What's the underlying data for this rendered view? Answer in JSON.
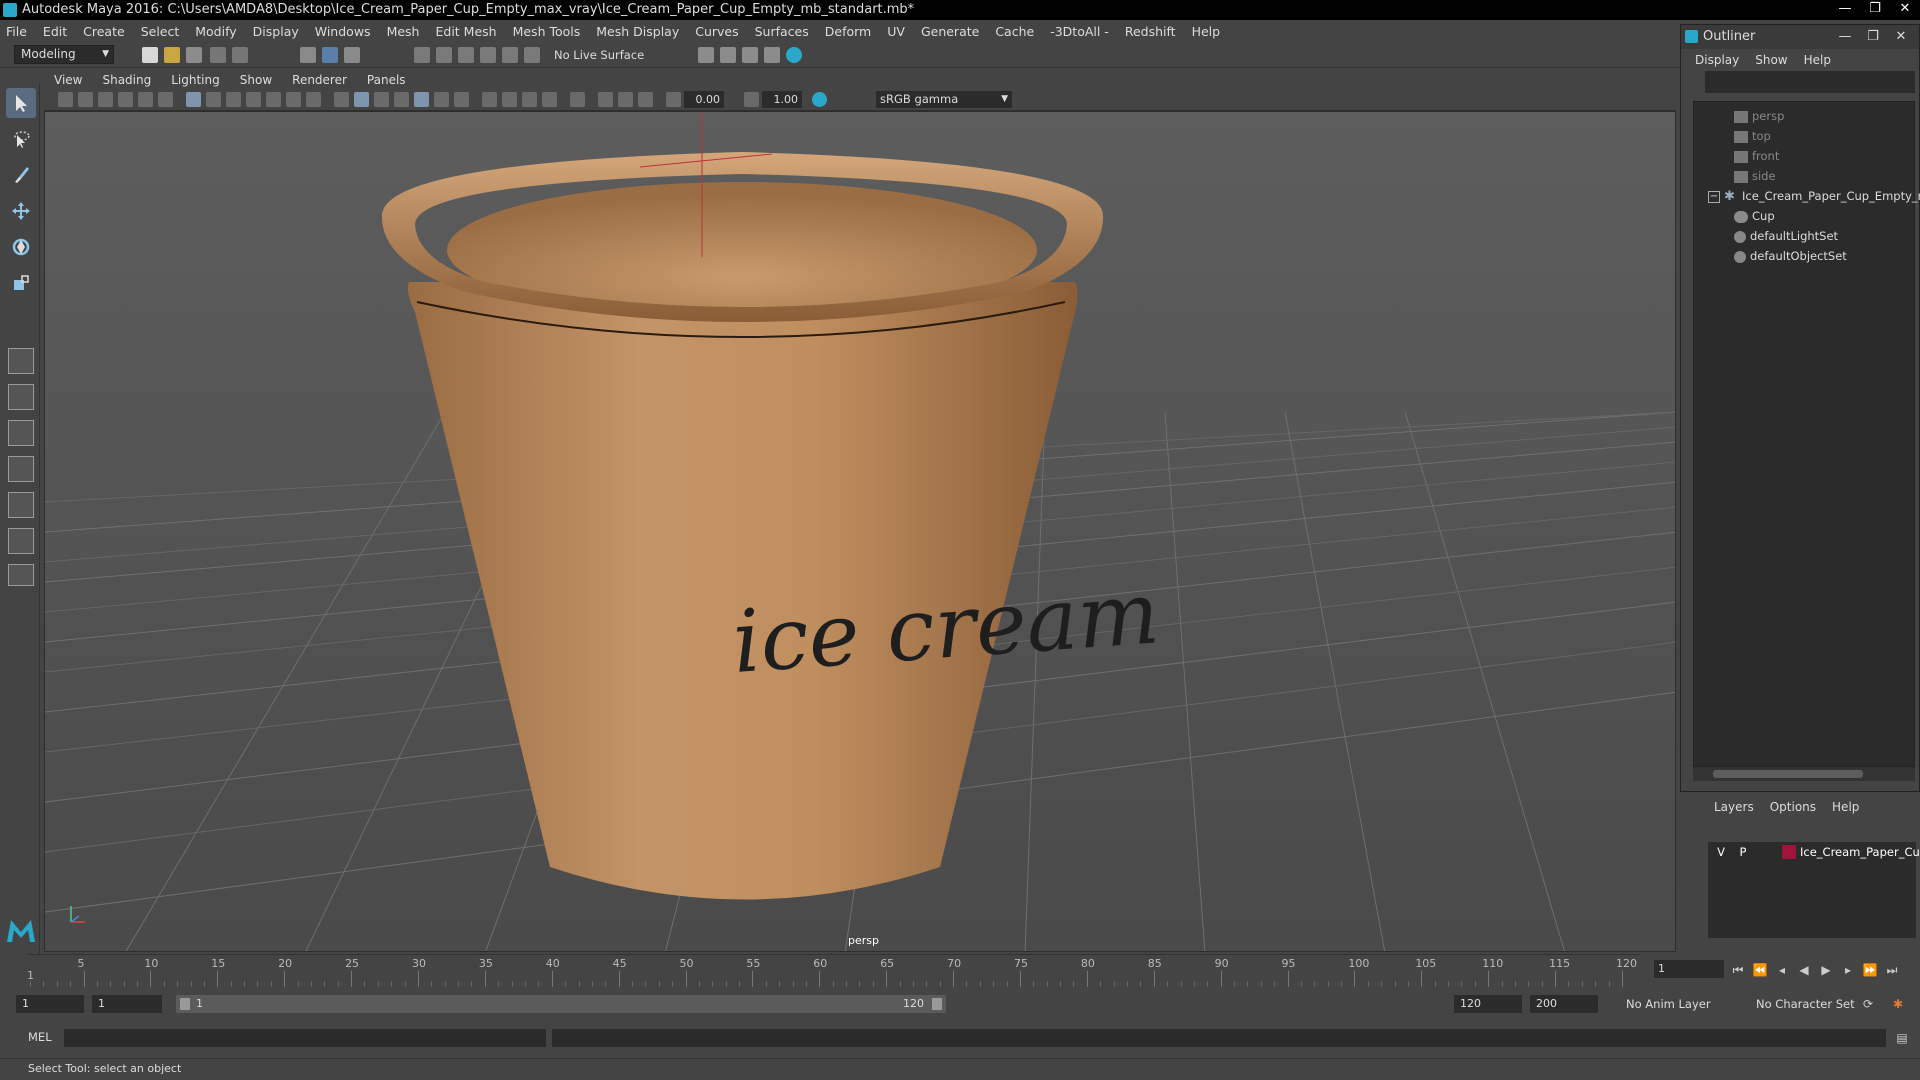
{
  "window": {
    "title": "Autodesk Maya 2016: C:\\Users\\AMDA8\\Desktop\\Ice_Cream_Paper_Cup_Empty_max_vray\\Ice_Cream_Paper_Cup_Empty_mb_standart.mb*",
    "minimize": "—",
    "maximize": "❐",
    "close": "✕"
  },
  "menubar": [
    "File",
    "Edit",
    "Create",
    "Select",
    "Modify",
    "Display",
    "Windows",
    "Mesh",
    "Edit Mesh",
    "Mesh Tools",
    "Mesh Display",
    "Curves",
    "Surfaces",
    "Deform",
    "UV",
    "Generate",
    "Cache",
    "-3DtoAll -",
    "Redshift",
    "Help"
  ],
  "statusline": {
    "mode": "Modeling",
    "live_surface": "No Live Surface"
  },
  "panel": {
    "menu": [
      "View",
      "Shading",
      "Lighting",
      "Show",
      "Renderer",
      "Panels"
    ],
    "exposure": "0.00",
    "gamma": "1.00",
    "color_space": "sRGB gamma",
    "camera": "persp"
  },
  "scene": {
    "cup_text": "ice cream"
  },
  "outliner": {
    "title": "Outliner",
    "menu": [
      "Display",
      "Show",
      "Help"
    ],
    "items": [
      {
        "label": "persp",
        "dim": true
      },
      {
        "label": "top",
        "dim": true
      },
      {
        "label": "front",
        "dim": true
      },
      {
        "label": "side",
        "dim": true
      },
      {
        "label": "Ice_Cream_Paper_Cup_Empty_n",
        "dim": false
      },
      {
        "label": "Cup",
        "dim": false
      },
      {
        "label": "defaultLightSet",
        "dim": false
      },
      {
        "label": "defaultObjectSet",
        "dim": false
      }
    ]
  },
  "layers": {
    "menu": [
      "Layers",
      "Options",
      "Help"
    ],
    "row": {
      "v": "V",
      "p": "P",
      "name": "Ice_Cream_Paper_Cup_",
      "color": "#a0143c"
    }
  },
  "timeline": {
    "ticks": [
      "5",
      "10",
      "15",
      "20",
      "25",
      "30",
      "35",
      "40",
      "45",
      "50",
      "55",
      "60",
      "65",
      "70",
      "75",
      "80",
      "85",
      "90",
      "95",
      "100",
      "105",
      "110",
      "115",
      "120"
    ],
    "start_label": "1",
    "current_frame": "1"
  },
  "range": {
    "start": "1",
    "playback_start": "1",
    "bar_start": "1",
    "bar_end": "120",
    "playback_end": "120",
    "end": "200",
    "anim_layer": "No Anim Layer",
    "char_set": "No Character Set"
  },
  "command": {
    "label": "MEL",
    "help": "Select Tool: select an object"
  }
}
